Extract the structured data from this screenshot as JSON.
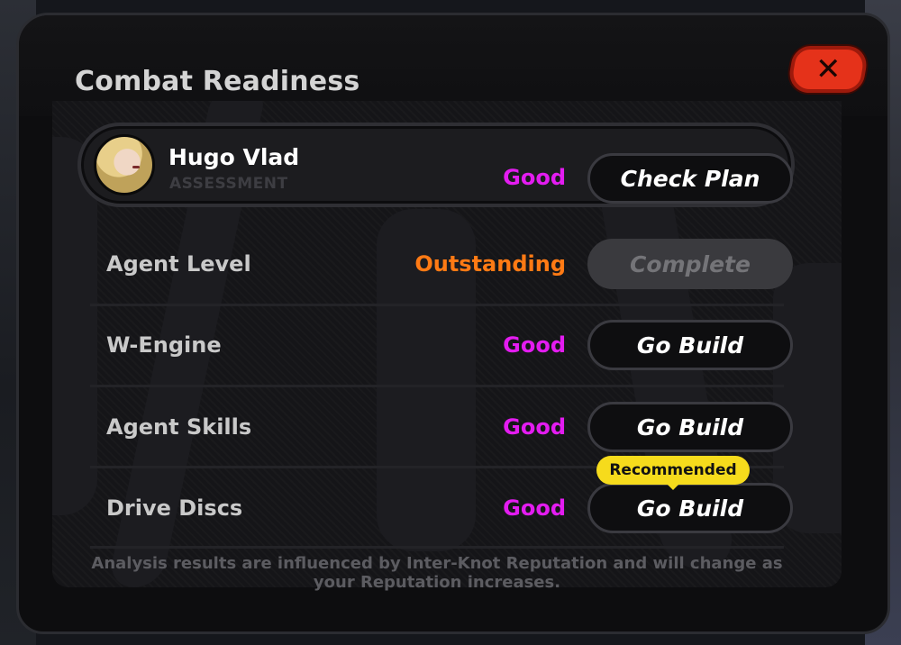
{
  "modal": {
    "title": "Combat Readiness",
    "close_icon": "close-icon"
  },
  "agent": {
    "name": "Hugo Vlad",
    "subtitle": "ASSESSMENT",
    "grade": "Good",
    "button_label": "Check Plan"
  },
  "rows": [
    {
      "label": "Agent Level",
      "grade": "Outstanding",
      "button_label": "Complete",
      "button_state": "disabled"
    },
    {
      "label": "W-Engine",
      "grade": "Good",
      "button_label": "Go Build"
    },
    {
      "label": "Agent Skills",
      "grade": "Good",
      "button_label": "Go Build"
    },
    {
      "label": "Drive Discs",
      "grade": "Good",
      "button_label": "Go Build",
      "badge": "Recommended"
    }
  ],
  "footnote": "Analysis results are influenced by Inter-Knot Reputation and will change as your Reputation increases.",
  "colors": {
    "good": "#e31cf0",
    "outstanding": "#ff7a14",
    "close_button": "#e5321a",
    "badge": "#f6db1c"
  }
}
